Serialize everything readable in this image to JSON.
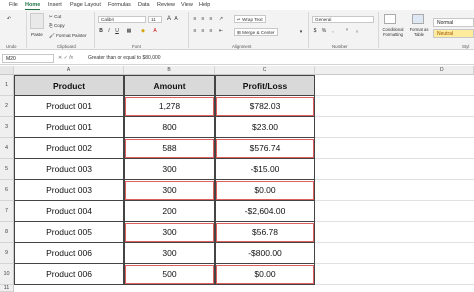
{
  "menu": [
    "File",
    "Home",
    "Insert",
    "Page Layout",
    "Formulas",
    "Data",
    "Review",
    "View",
    "Help"
  ],
  "ribbon": {
    "cut": "Cut",
    "copy": "Copy",
    "format_painter": "Format Painter",
    "paste": "Paste",
    "font_name": "Calibri",
    "font_size": "11",
    "wrap_text": "Wrap Text",
    "merge_center": "Merge & Center",
    "number_format": "General",
    "conditional_formatting": "Conditional Formatting",
    "format_as_table": "Format as Table",
    "style_normal": "Normal",
    "style_neutral": "Neutral",
    "groups": {
      "undo": "Undo",
      "clipboard": "Clipboard",
      "font": "Font",
      "alignment": "Alignment",
      "number": "Number",
      "styles": "Styl"
    }
  },
  "formula_bar": {
    "name_box": "M20",
    "formula": "Greater than or equal to $80,000"
  },
  "columns": [
    "A",
    "B",
    "C",
    "D"
  ],
  "rows": [
    "1",
    "2",
    "3",
    "4",
    "5",
    "6",
    "7",
    "8",
    "9",
    "10",
    "11"
  ],
  "table": {
    "headers": [
      "Product",
      "Amount",
      "Profit/Loss"
    ],
    "rows": [
      [
        "Product 001",
        "1,278",
        "$782.03"
      ],
      [
        "Product 001",
        "800",
        "$23.00"
      ],
      [
        "Product 002",
        "588",
        "$576.74"
      ],
      [
        "Product 003",
        "300",
        "-$15.00"
      ],
      [
        "Product 003",
        "300",
        "$0.00"
      ],
      [
        "Product 004",
        "200",
        "-$2,604.00"
      ],
      [
        "Product 005",
        "300",
        "$56.78"
      ],
      [
        "Product 006",
        "300",
        "-$800.00"
      ],
      [
        "Product 006",
        "500",
        "$0.00"
      ]
    ]
  },
  "colors": {
    "accent": "#217346",
    "header_fill": "#d9d9d9",
    "highlight": "#e06060"
  }
}
